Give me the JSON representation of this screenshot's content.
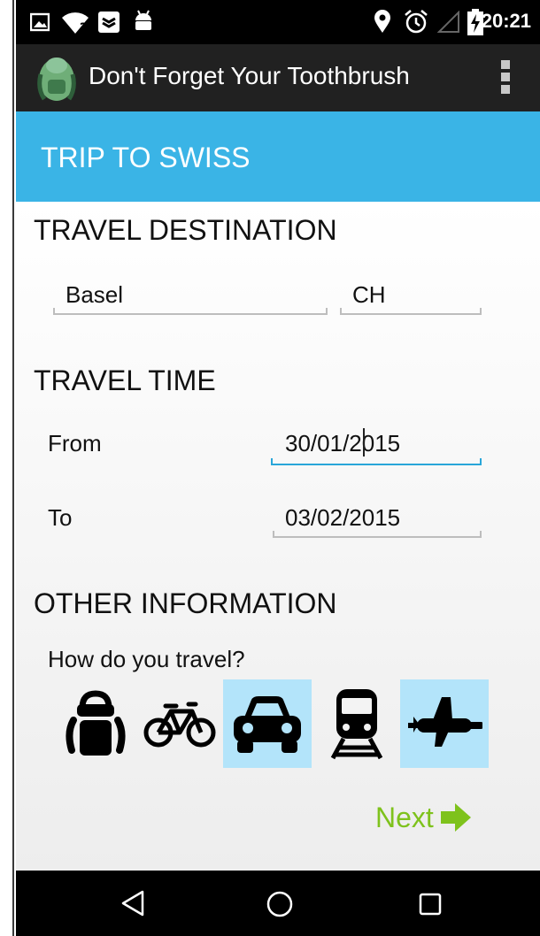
{
  "status_bar": {
    "time": "20:21",
    "icons": [
      "image-icon",
      "wifi-unknown-icon",
      "app-notification-icon",
      "android-icon",
      "location-icon",
      "alarm-icon",
      "signal-icon",
      "battery-charging-icon"
    ]
  },
  "app_bar": {
    "title": "Don't Forget Your Toothbrush",
    "logo_icon": "backpack-logo-icon",
    "menu_icon": "overflow-menu-icon"
  },
  "trip": {
    "title": "TRIP TO SWISS"
  },
  "destination": {
    "section_title": "TRAVEL DESTINATION",
    "city": "Basel",
    "country": "CH"
  },
  "time": {
    "section_title": "TRAVEL TIME",
    "from_label": "From",
    "from_value": "30/01/2015",
    "to_label": "To",
    "to_value": "03/02/2015"
  },
  "other": {
    "section_title": "OTHER INFORMATION",
    "question": "How do you travel?",
    "transport_options": [
      {
        "icon": "backpack-icon",
        "selected": false
      },
      {
        "icon": "bicycle-icon",
        "selected": false
      },
      {
        "icon": "car-icon",
        "selected": true
      },
      {
        "icon": "train-icon",
        "selected": false
      },
      {
        "icon": "airplane-icon",
        "selected": true
      }
    ]
  },
  "next_button": {
    "label": "Next"
  },
  "nav_bar": {
    "icons": [
      "back-icon",
      "home-icon",
      "recents-icon"
    ]
  },
  "colors": {
    "accent": "#3ab4e6",
    "selected_bg": "#b3e4fa",
    "next_green": "#7ec21c",
    "focus_line": "#29a6d9"
  }
}
